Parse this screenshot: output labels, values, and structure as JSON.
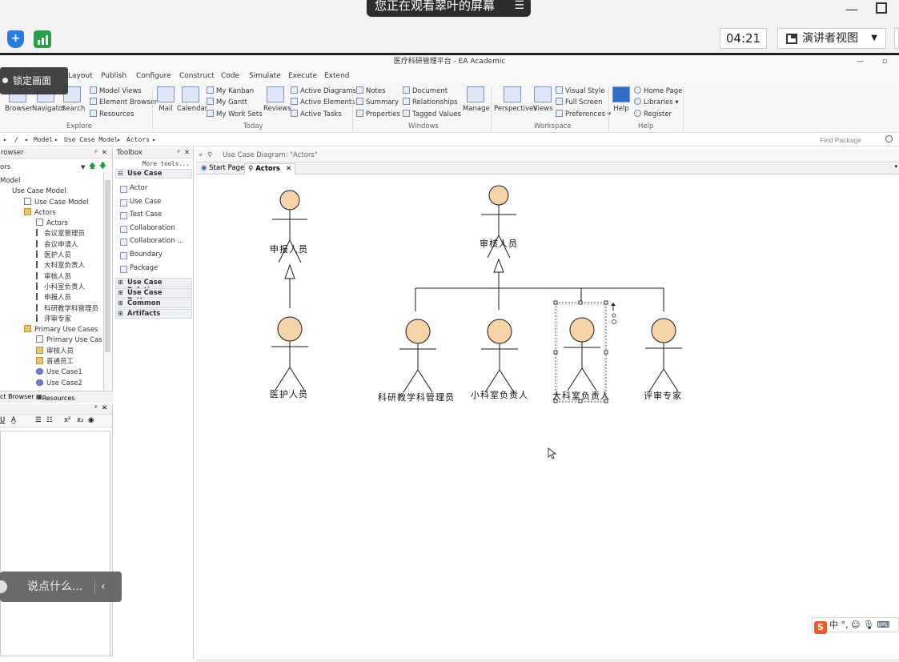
{
  "meeting": {
    "share_banner": "您正在观看翠叶的屏幕",
    "timer": "04:21",
    "presenter_view": "演讲者视图",
    "lock_tooltip": "锁定画面",
    "chat_placeholder": "说点什么..."
  },
  "window": {
    "title": "医疗科研管理平台 - EA Academic"
  },
  "menu": [
    "Layout",
    "Publish",
    "Configure",
    "Construct",
    "Code",
    "Simulate",
    "Execute",
    "Extend"
  ],
  "ribbon": {
    "explore": {
      "label": "Explore",
      "big": [
        "Browser",
        "Navigator",
        "Search"
      ],
      "small": [
        "Model Views",
        "Element Browser",
        "Resources"
      ]
    },
    "today": {
      "label": "Today",
      "big": [
        "Mail",
        "Calendar"
      ],
      "small": [
        "My Kanban",
        "My Gantt",
        "My Work Sets"
      ],
      "reviews": "Reviews",
      "active": [
        "Active Diagrams",
        "Active Elements",
        "Active Tasks"
      ]
    },
    "windows": {
      "label": "Windows",
      "col1": [
        "Notes",
        "Summary",
        "Properties"
      ],
      "col2": [
        "Document",
        "Relationships",
        "Tagged Values"
      ],
      "manage": "Manage"
    },
    "workspace": {
      "label": "Workspace",
      "perspectives": "Perspectives",
      "views": "Views",
      "small": [
        "Visual Style",
        "Full Screen",
        "Preferences"
      ]
    },
    "help": {
      "label": "Help",
      "big": "Help",
      "small": [
        "Home Page",
        "Libraries",
        "Register"
      ]
    }
  },
  "breadcrumb": [
    "/",
    "Model",
    "Use Case Model",
    "Actors"
  ],
  "find_package": "Find Package",
  "browser": {
    "title": "rowser",
    "selector": "ors",
    "tree": [
      {
        "label": "Model",
        "indent": 0,
        "icon": "none"
      },
      {
        "label": "Use Case Model",
        "indent": 1,
        "icon": "none"
      },
      {
        "label": "Use Case Model",
        "indent": 2,
        "icon": "diag"
      },
      {
        "label": "Actors",
        "indent": 2,
        "icon": "folder"
      },
      {
        "label": "Actors",
        "indent": 3,
        "icon": "diag"
      },
      {
        "label": "会议室管理员",
        "indent": 3,
        "icon": "actor"
      },
      {
        "label": "会议申请人",
        "indent": 3,
        "icon": "actor"
      },
      {
        "label": "医护人员",
        "indent": 3,
        "icon": "actor"
      },
      {
        "label": "大科室负责人",
        "indent": 3,
        "icon": "actor"
      },
      {
        "label": "审核人员",
        "indent": 3,
        "icon": "actor"
      },
      {
        "label": "小科室负责人",
        "indent": 3,
        "icon": "actor"
      },
      {
        "label": "申报人员",
        "indent": 3,
        "icon": "actor"
      },
      {
        "label": "科研教学科管理员",
        "indent": 3,
        "icon": "actor"
      },
      {
        "label": "评审专家",
        "indent": 3,
        "icon": "actor"
      },
      {
        "label": "Primary Use Cases",
        "indent": 2,
        "icon": "folder"
      },
      {
        "label": "Primary Use Cases",
        "indent": 3,
        "icon": "diag"
      },
      {
        "label": "审核人员",
        "indent": 3,
        "icon": "folder"
      },
      {
        "label": "普通员工",
        "indent": 3,
        "icon": "folder"
      },
      {
        "label": "Use Case1",
        "indent": 3,
        "icon": "uc"
      },
      {
        "label": "Use Case2",
        "indent": 3,
        "icon": "uc"
      }
    ],
    "tabs": [
      "ct Browser",
      "Resources"
    ]
  },
  "toolbox": {
    "title": "Toolbox",
    "more_tools": "More tools...",
    "sections": {
      "use_case": "Use Case",
      "relations": "Use Case Relations...",
      "patterns": "Use Case Patterns",
      "common": "Common",
      "artifacts": "Artifacts"
    },
    "items": [
      "Actor",
      "Use Case",
      "Test Case",
      "Collaboration",
      "Collaboration ...",
      "Boundary",
      "Package"
    ]
  },
  "diagram": {
    "header": "Use Case Diagram: \"Actors\"",
    "tabs": [
      "Start Page",
      "Actors"
    ],
    "actors": {
      "a1": "申报人员",
      "a2": "医护人员",
      "a3": "审核人员",
      "a4": "科研教学科管理员",
      "a5": "小科室负责人",
      "a6": "大科室负责人",
      "a7": "评审专家"
    }
  },
  "ime": {
    "mode": "中"
  },
  "colors": {
    "actor_fill": "#f6d4a8",
    "actor_stroke": "#1a1a1a",
    "accent_blue": "#2a7be0",
    "signal_green": "#27a146"
  }
}
